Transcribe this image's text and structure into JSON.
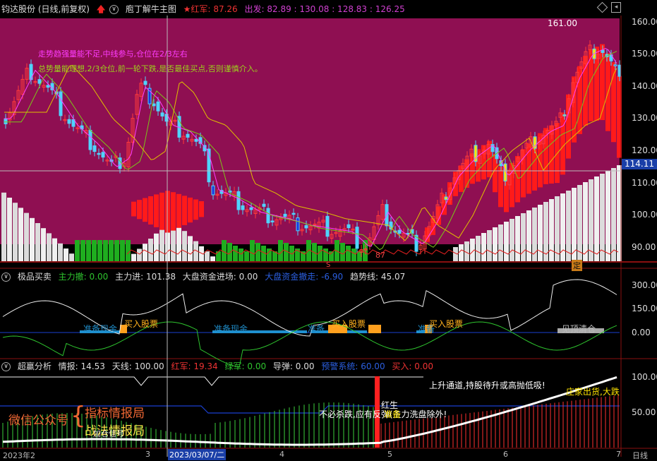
{
  "header": {
    "stock_title": "钧达股份 (日线,前复权)",
    "indicator_name": "庖丁解牛主图",
    "hong_jun_label": "★红军:",
    "hong_jun_value": "87.26",
    "chu_fa_label": "出发:",
    "chu_fa_values": "82.89 : 130.08 : 128.83 : 126.25",
    "arrow_icon": "red-up-arrow-icon"
  },
  "main_notes": {
    "line1": "走势趋强量能不足,中线参与,仓位在2/3左右",
    "line2": "总势量能理想,2/3仓位,前一轮下跌,是否最佳买点,否则谨慎介入。"
  },
  "main_axis": {
    "ticks": [
      "160.00",
      "150.00",
      "140.00",
      "130.00",
      "120.00",
      "110.00",
      "100.00",
      "90.00"
    ],
    "crosshair_price": "114.11",
    "peak_label": "161.00",
    "low_label": "87",
    "marker_s": "S",
    "marker_ding": "定"
  },
  "panel2": {
    "title": "极品买卖",
    "main_exit_label": "主力撤:",
    "main_exit_value": "0.00",
    "main_in_label": "主力进:",
    "main_in_value": "101.38",
    "big_in_label": "大盘资金进场:",
    "big_in_value": "0.00",
    "big_out_label": "大盘资金撤走:",
    "big_out_value": "-6.90",
    "trend_label": "趋势线:",
    "trend_value": "45.07",
    "ticks": [
      "300.00",
      "150.00",
      "0.00"
    ],
    "signals": [
      "准备现金",
      "买入股票",
      "准备现金",
      "准备",
      "买入股票",
      "准备",
      "买入股票",
      "见顶清仓"
    ]
  },
  "panel3": {
    "title": "超赢分析",
    "qingbao_label": "情报:",
    "qingbao_value": "14.53",
    "tianxian_label": "天线:",
    "tianxian_value": "100.00",
    "hongjun_label": "红军:",
    "hongjun_value": "19.34",
    "lvjun_label": "绿军:",
    "lvjun_value": "0.00",
    "daodan_label": "导弹:",
    "daodan_value": "0.00",
    "yujing_label": "预警系统:",
    "yujing_value": "60.00",
    "mairu_label": "买入:",
    "mairu_value": "0.00",
    "ticks": [
      "100.00",
      "50.00"
    ],
    "msg_up": "上升通道,持股待升或高抛低吸!",
    "msg_hong": "红生",
    "msg_nokill": "不必杀跌,应有反弹(主力洗盘除外!",
    "msg_zhuangjia": "庄家出货,大跌",
    "msg_zhunbei": "准备",
    "promo_wechat": "微信公众号",
    "promo_brace": "{",
    "promo_line1": "指标情报局",
    "promo_line2": "战法情报局",
    "promo_small": "加仓信号"
  },
  "xaxis": {
    "labels": [
      "2023年2",
      "3",
      "2023/03/07/二",
      "4",
      "5",
      "6",
      "7"
    ],
    "right_label": "日线"
  }
}
